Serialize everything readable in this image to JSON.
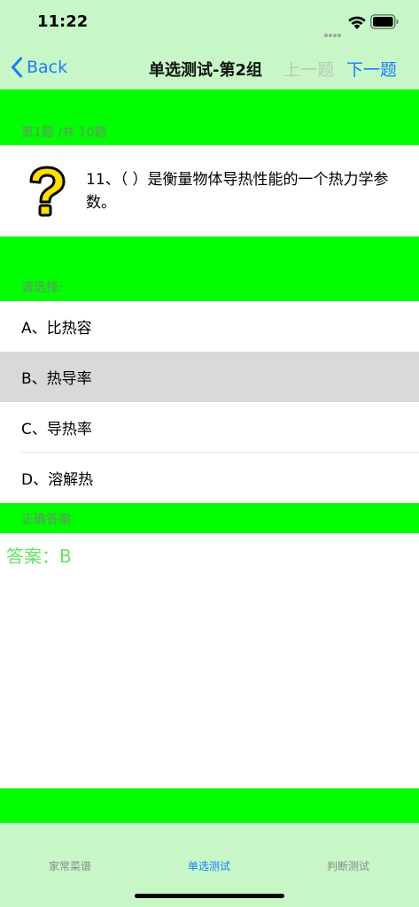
{
  "status": {
    "time": "11:22"
  },
  "nav": {
    "back_label": "Back",
    "title": "单选测试-第2组",
    "prev_label": "上一题",
    "next_label": "下一题"
  },
  "question": {
    "progress": "第1题 /共 10题",
    "text": "11、（ ）是衡量物体导热性能的一个热力学参数。"
  },
  "choices": {
    "label": "请选择:",
    "options": [
      {
        "text": "A、比热容"
      },
      {
        "text": "B、热导率"
      },
      {
        "text": "C、导热率"
      },
      {
        "text": "D、溶解热"
      }
    ],
    "selected_index": 1
  },
  "answer": {
    "label": "正确答案:",
    "text": "答案：B"
  },
  "tabs": [
    {
      "label": "家常菜谱"
    },
    {
      "label": "单选测试"
    },
    {
      "label": "判断测试"
    }
  ],
  "colors": {
    "band": "#00ff00",
    "bars": "#c7f7c7",
    "accent": "#1a7cff",
    "answer": "#66e066",
    "selected": "#d9d9d9"
  }
}
